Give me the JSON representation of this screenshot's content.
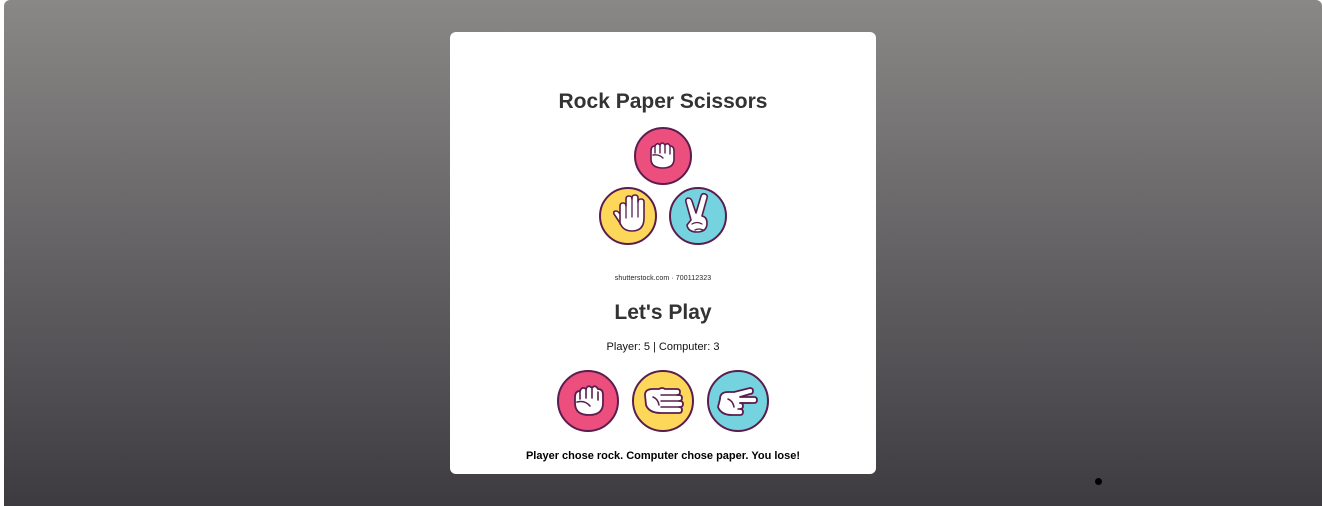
{
  "game": {
    "title": "Rock Paper Scissors",
    "hero_caption": "shutterstock.com · 700112323",
    "subtitle": "Let's Play",
    "score_text": "Player: 5 | Computer: 3",
    "result_text": "Player chose rock. Computer chose paper. You lose!"
  },
  "choices": [
    {
      "name": "rock",
      "color": "#ec4e7d"
    },
    {
      "name": "paper",
      "color": "#fdd75a"
    },
    {
      "name": "scissors",
      "color": "#74d3de"
    }
  ],
  "colors": {
    "outline": "#5a1d4e",
    "rock": "#ec4e7d",
    "paper": "#fdd75a",
    "scissors": "#74d3de"
  }
}
